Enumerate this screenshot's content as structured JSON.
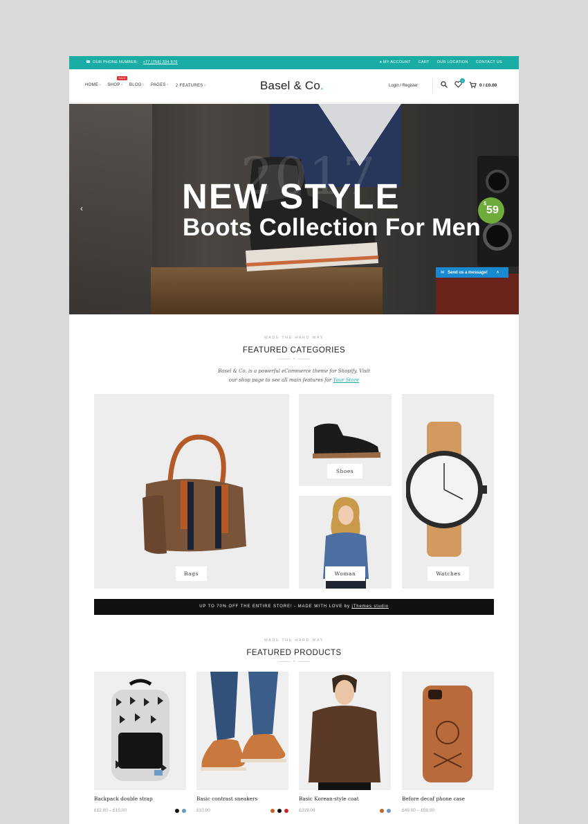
{
  "topbar": {
    "phone_label": "OUR PHONE NUMBER:",
    "phone_number": "+77 (756) 334 876",
    "links": [
      "MY ACCOUNT",
      "CART",
      "OUR LOCATION",
      "CONTACT US"
    ]
  },
  "header": {
    "nav": [
      "HOME",
      "SHOP",
      "BLOG",
      "PAGES",
      "FEATURES"
    ],
    "sale_badge": "SALE",
    "logo": "Basel & Co",
    "logo_dot": ".",
    "login": "Login / Register",
    "wishlist_count": "0",
    "cart_summary": "0 / £0.00"
  },
  "hero": {
    "year": "2017",
    "headline": "NEW STYLE",
    "subheadline": "Boots Collection For Men",
    "price_symbol": "$",
    "price": "59",
    "message_button": "Send us a message!"
  },
  "categories_section": {
    "kicker": "MADE THE HARD WAY",
    "title": "FEATURED CATEGORIES",
    "intro_line1": "Basel & Co. is a powerful eCommerce theme for Shopify. Visit",
    "intro_line2": "our shop page to see all main features for",
    "intro_link": "Your Store",
    "items": [
      "Bags",
      "Shoes",
      "Woman",
      "Watches"
    ]
  },
  "promo": {
    "text": "UP TO 70% OFF THE ENTIRE STORE! - MADE WITH LOVE by",
    "brand": "jThemes studio"
  },
  "products_section": {
    "kicker": "MADE THE HARD WAY",
    "title": "FEATURED PRODUCTS",
    "items": [
      {
        "name": "Backpack double strap",
        "price": "£12.00 – £15.00",
        "swatches": [
          "#111111",
          "#6a9bc4"
        ]
      },
      {
        "name": "Basic contrast sneakers",
        "price": "£10.00",
        "swatches": [
          "#c2652a",
          "#111111",
          "#c8262a"
        ]
      },
      {
        "name": "Basic Korean-style coat",
        "price": "£219.00",
        "swatches": [
          "#c2652a",
          "#6a9bc4"
        ]
      },
      {
        "name": "Before decaf phone case",
        "price": "£49.00 – £59.00",
        "swatches": []
      }
    ]
  },
  "colors": {
    "accent": "#1aada5",
    "sale": "#e03232",
    "price_badge": "#6dab3a",
    "message_button": "#1a8ad0"
  }
}
